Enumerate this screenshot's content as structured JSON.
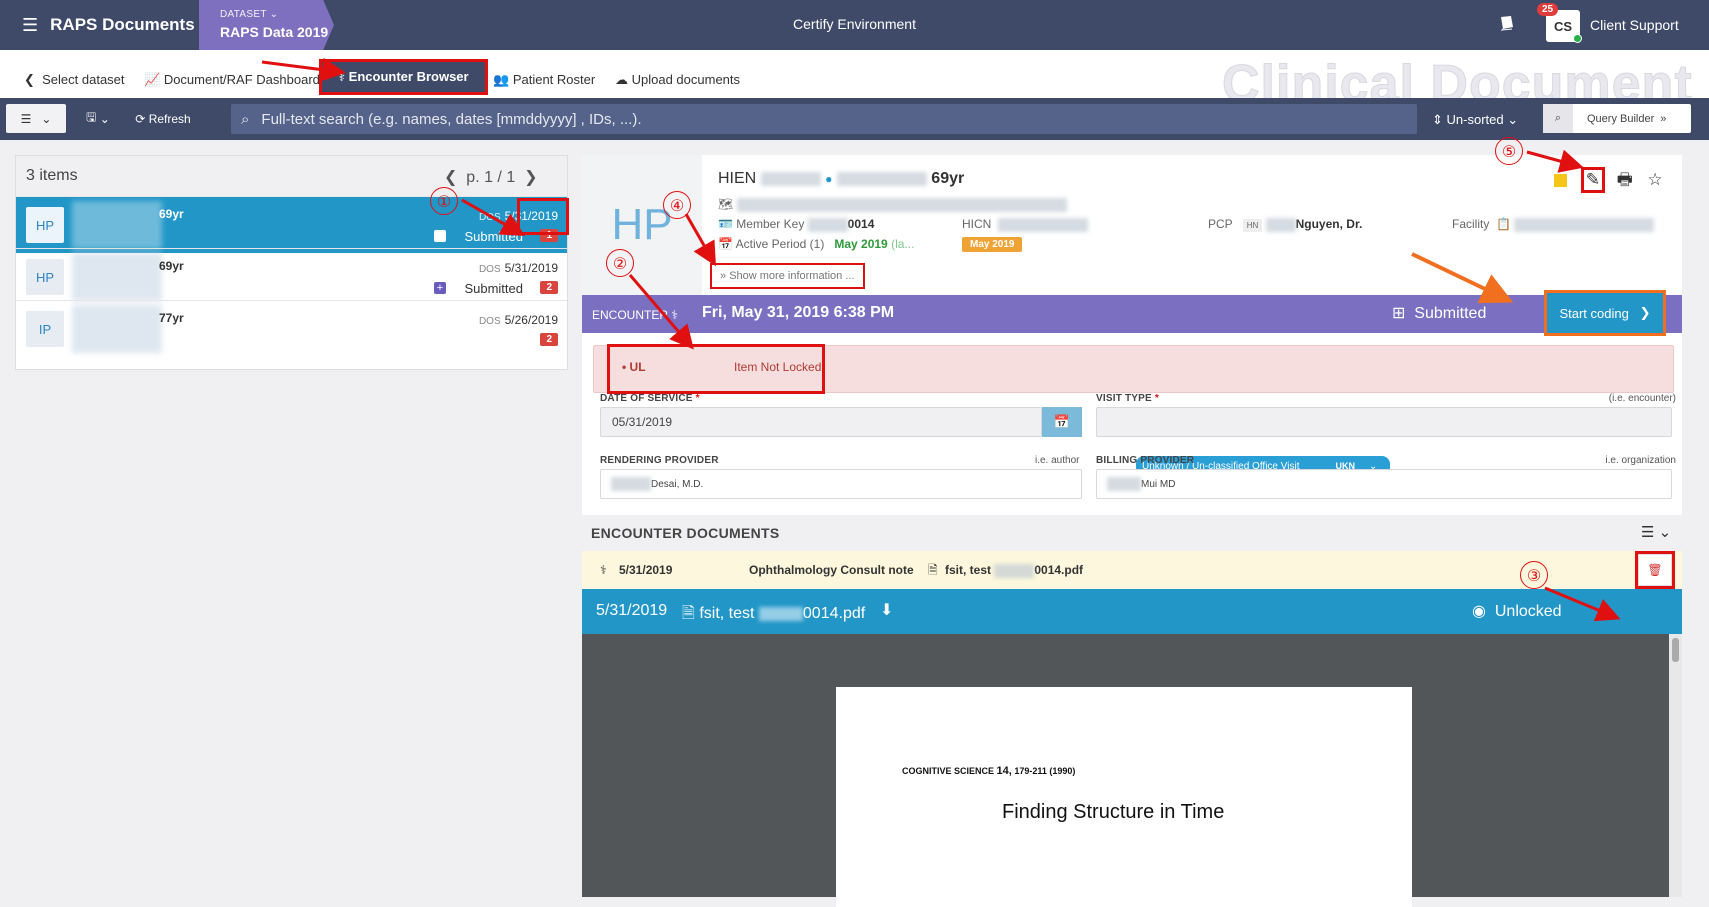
{
  "topbar": {
    "app_title": "RAPS Documents",
    "dataset_label": "DATASET",
    "dataset_value": "RAPS Data 2019",
    "environment": "Certify Environment",
    "notification_count": "25",
    "avatar_initials": "CS",
    "user_label": "Client Support"
  },
  "nav": {
    "items": [
      "Select dataset",
      "Document/RAF Dashboard",
      "Encounter Browser",
      "Patient Roster",
      "Upload documents"
    ],
    "watermark": "Clinical Document"
  },
  "toolbar": {
    "refresh_label": "Refresh",
    "search_placeholder": "Full-text search (e.g. names, dates [mmddyyyy] , IDs, ...).",
    "sort_label": "Un-sorted",
    "query_builder_label": "Query Builder"
  },
  "list": {
    "count_label": "3 items",
    "pager": "p. 1 / 1",
    "dos_prefix": "DOS",
    "rows": [
      {
        "type": "HP",
        "age": "69yr",
        "dos": "5/31/2019",
        "status": "Submitted",
        "count": "1"
      },
      {
        "type": "HP",
        "age": "69yr",
        "dos": "5/31/2019",
        "status": "Submitted",
        "count": "2"
      },
      {
        "type": "IP",
        "age": "77yr",
        "dos": "5/26/2019",
        "status": "",
        "count": "2"
      }
    ]
  },
  "patient": {
    "avatar": "HP",
    "name_prefix": "HIEN",
    "age": "69yr",
    "member_key_label": "Member Key",
    "member_key_suffix": "0014",
    "active_period_label": "Active Period",
    "active_period_count": "(1)",
    "active_period_value": "May 2019",
    "active_period_extra": "(la...",
    "hicn_label": "HICN",
    "hicn_badge": "May 2019",
    "pcp_label": "PCP",
    "pcp_badge": "HN",
    "pcp_name": "Nguyen, Dr.",
    "facility_label": "Facility",
    "show_more": "Show more information ..."
  },
  "encounter": {
    "label": "ENCOUNTER",
    "datetime": "Fri, May 31, 2019 6:38 PM",
    "status": "Submitted",
    "start_coding": "Start coding"
  },
  "alert": {
    "code": "UL",
    "message": "Item Not Locked"
  },
  "form": {
    "dos_label": "DATE OF SERVICE",
    "dos_value": "05/31/2019",
    "visit_type_label": "VISIT TYPE",
    "visit_type_hint": "(i.e. encounter)",
    "visit_type_value": "Unknown / Un-classified Office Visit",
    "visit_type_code": "UKN",
    "rendering_label": "RENDERING PROVIDER",
    "rendering_hint": "i.e. author",
    "rendering_value": "Desai, M.D.",
    "billing_label": "BILLING PROVIDER",
    "billing_hint": "i.e. organization",
    "billing_value": "Mui MD"
  },
  "documents": {
    "header": "ENCOUNTER DOCUMENTS",
    "row_date": "5/31/2019",
    "row_type": "Ophthalmology Consult note",
    "row_file_prefix": "fsit, test",
    "row_file_suffix": "0014.pdf",
    "bar_date": "5/31/2019",
    "bar_file_prefix": "fsit, test",
    "bar_file_suffix": "0014.pdf",
    "lock_status": "Unlocked"
  },
  "pdf": {
    "journal": "COGNITIVE SCIENCE",
    "volume": "14,",
    "pages": "179-211 (1990)",
    "title": "Finding Structure in Time"
  },
  "annotations": [
    "①",
    "②",
    "③",
    "④",
    "⑤"
  ],
  "colors": {
    "topbar": "#3e4a68",
    "dataset": "#7e6fbf",
    "encounter_bar": "#7b6fc1",
    "accent": "#2196c7",
    "annotation": "#e01010",
    "highlight_orange": "#f07020"
  }
}
